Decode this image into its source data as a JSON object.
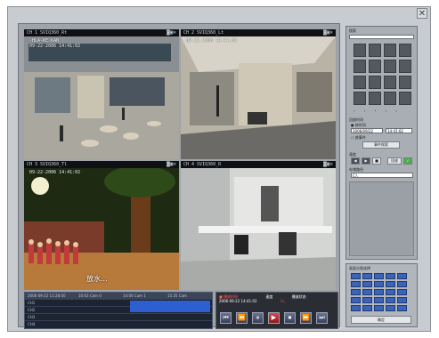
{
  "window": {
    "close_glyph": "✕"
  },
  "cameras": [
    {
      "title": "CH 1 SVIQ360_Rt",
      "osd_date": "09-22-2006 14:41:02",
      "sign": "-HLA-KE KAN"
    },
    {
      "title": "CH 2 SVIQ360_Lt",
      "osd_date": "09-22-2006 14:41:02"
    },
    {
      "title": "CH 3 SVIQ360_Tl",
      "osd_date": "09-22-2006 14:41:02",
      "subtitle": "放水..."
    },
    {
      "title": "CH 4 SVIQ360_R",
      "osd_date": ""
    }
  ],
  "timeline": {
    "headers": [
      "2006-09-22 11:28:00",
      "10:03 Cam 0",
      "14:00 Cam 1",
      "15:35 Cam"
    ],
    "rows": [
      "CH1",
      "CH2",
      "CH3",
      "CH4"
    ]
  },
  "playback": {
    "info_left": "■ 播放时间",
    "info_mid": "速度",
    "info_right": "播放状态",
    "time": "2006-09-22 14:41:02",
    "speed": "1x",
    "controls": [
      "⏮",
      "⏪",
      "⏸",
      "▶",
      "⏹",
      "⏩",
      "⏭"
    ]
  },
  "sidebar": {
    "title": "搜索",
    "nav_arrows": [
      "‹",
      "‹",
      "•",
      "›",
      "›"
    ],
    "date_label": "回放时间",
    "radio1": "按时间",
    "date_value": "2006/09/22",
    "time_value": "14:41:02",
    "radio2": "按事件",
    "search_btn": "事件搜索",
    "speed_label": "速度",
    "play_btn": "回放",
    "path_label": "存储路径",
    "path_value": "C:\\"
  },
  "layout_panel": {
    "title": "画面分割选择",
    "confirm": "确定"
  },
  "colors": {
    "accent": "#e02020",
    "timeline_fill": "#2e5fd0"
  }
}
